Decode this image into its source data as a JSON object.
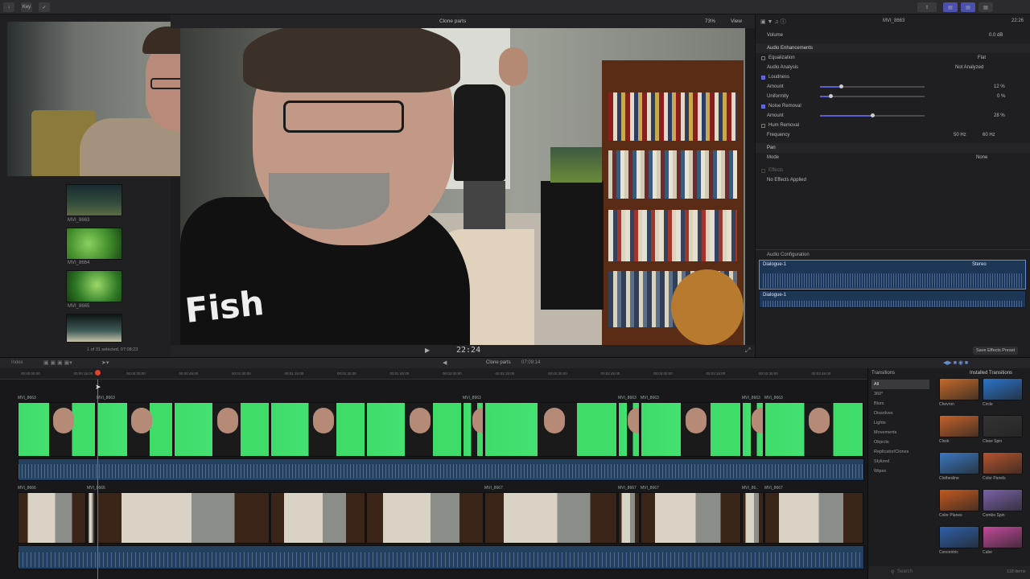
{
  "topbar": {
    "keyword_label": "Key"
  },
  "viewer": {
    "title": "Clone parts",
    "zoom": "73%",
    "view_label": "View",
    "timecode": "22:24"
  },
  "browser": {
    "clips": [
      {
        "label": "MVI_8663"
      },
      {
        "label": "MVI_8664"
      },
      {
        "label": "MVI_8665"
      }
    ],
    "status": "1 of 31 selected, 07:08:23"
  },
  "inspector": {
    "clip_name": "MVI_8663",
    "duration": "22:26",
    "volume_label": "Volume",
    "volume_value": "0.0 dB",
    "enhancements_label": "Audio Enhancements",
    "equalization_label": "Equalization",
    "equalization_value": "Flat",
    "analysis_label": "Audio Analysis",
    "analysis_value": "Not Analyzed",
    "loudness_label": "Loudness",
    "amount_label": "Amount",
    "amount_value": "12 %",
    "amount_fraction": 0.2,
    "uniformity_label": "Uniformity",
    "uniformity_value": "0 %",
    "uniformity_fraction": 0.1,
    "noise_label": "Noise Removal",
    "noise_amount_label": "Amount",
    "noise_amount_value": "28 %",
    "noise_amount_fraction": 0.5,
    "hum_label": "Hum Removal",
    "frequency_label": "Frequency",
    "freq_50": "50 Hz",
    "freq_60": "60 Hz",
    "pan_label": "Pan",
    "mode_label": "Mode",
    "mode_value": "None",
    "effects_label": "Effects",
    "no_effects": "No Effects Applied",
    "config_label": "Audio Configuration",
    "tracks": [
      {
        "name": "Dialogue-1",
        "format": "Stereo"
      },
      {
        "name": "Dialogue-1"
      }
    ],
    "save_preset": "Save Effects Preset"
  },
  "timeline": {
    "index_label": "Index",
    "project_title": "Clone parts",
    "project_duration": "07:09:14",
    "ruler_ticks": [
      "00:00:00:00",
      "00:00:15:00",
      "00:00:30:00",
      "00:00:45:00",
      "00:01:00:00",
      "00:01:15:00",
      "00:01:30:00",
      "00:01:45:00",
      "00:02:00:00",
      "00:02:15:00",
      "00:02:30:00",
      "00:02:45:00",
      "00:03:00:00",
      "00:03:15:00",
      "00:03:30:00",
      "00:03:45:00"
    ],
    "top_clips": [
      {
        "name": "MVI_8663"
      },
      {
        "name": "MVI_8663"
      },
      {
        "name": ""
      },
      {
        "name": ""
      },
      {
        "name": ""
      },
      {
        "name": "MVI_8663"
      },
      {
        "name": ""
      },
      {
        "name": "MVI_8663"
      },
      {
        "name": "MVI_8663"
      },
      {
        "name": "MVI_8663"
      },
      {
        "name": "MVI_8663"
      }
    ],
    "bottom_clips": [
      {
        "name": "MVI_8666"
      },
      {
        "name": "MVI_8666"
      },
      {
        "name": ""
      },
      {
        "name": ""
      },
      {
        "name": ""
      },
      {
        "name": "MVI_8667"
      },
      {
        "name": "MVI_8667"
      },
      {
        "name": "MVI_8667"
      },
      {
        "name": "MVI_86.."
      },
      {
        "name": "MVI_8667"
      }
    ]
  },
  "transitions": {
    "title": "Transitions",
    "installed_label": "Installed Transitions",
    "categories": [
      "All",
      "360°",
      "Blurs",
      "Dissolves",
      "Lights",
      "Movements",
      "Objects",
      "Replicator/Clones",
      "Stylized",
      "Wipes"
    ],
    "items": [
      {
        "label": "Chevron",
        "color": "#c46a2a"
      },
      {
        "label": "Circle",
        "color": "#2b74c9"
      },
      {
        "label": "Clock",
        "color": "#c4622a"
      },
      {
        "label": "Close Spin",
        "color": "#333333"
      },
      {
        "label": "Clothesline",
        "color": "#3b78c0"
      },
      {
        "label": "Color Panels",
        "color": "#b5542e"
      },
      {
        "label": "Color Planes",
        "color": "#c45a20"
      },
      {
        "label": "Combo Spin",
        "color": "#7a62a8"
      },
      {
        "label": "Concentric",
        "color": "#2f5fa8"
      },
      {
        "label": "Cube",
        "color": "#c24a9a"
      }
    ],
    "count": "118 items",
    "search_placeholder": "Search"
  },
  "colors": {
    "accent": "#5a5fd0",
    "green_screen": "#3fdc6a",
    "audio": "#23415f"
  }
}
